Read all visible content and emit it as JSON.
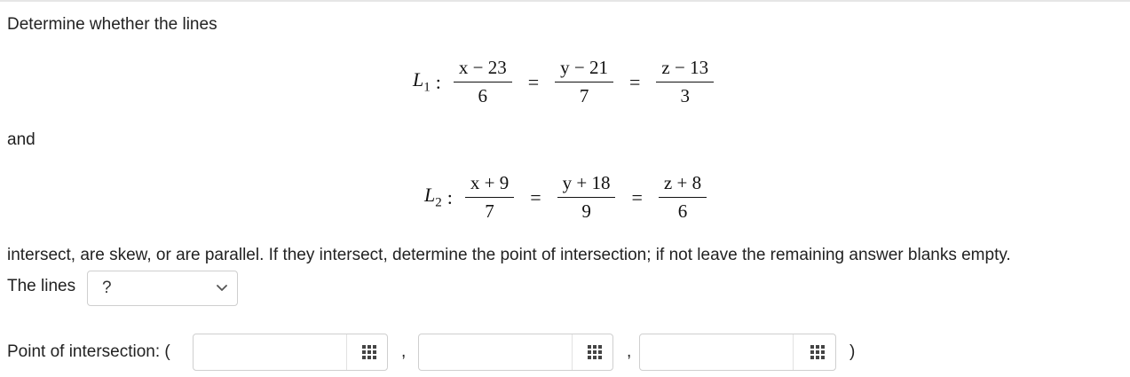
{
  "question": {
    "intro": "Determine whether the lines",
    "and": "and",
    "body": "intersect, are skew, or are parallel. If they intersect, determine the point of intersection; if not leave the remaining answer blanks empty.",
    "lines_label": "The lines",
    "point_label": "Point of intersection: (",
    "close_paren": ")",
    "separator": ","
  },
  "line1": {
    "name": "L",
    "sub": "1",
    "colon": ":",
    "x_num": "x − 23",
    "x_den": "6",
    "y_num": "y − 21",
    "y_den": "7",
    "z_num": "z − 13",
    "z_den": "3",
    "eq": "="
  },
  "line2": {
    "name": "L",
    "sub": "2",
    "colon": ":",
    "x_num": "x + 9",
    "x_den": "7",
    "y_num": "y + 18",
    "y_den": "9",
    "z_num": "z + 8",
    "z_den": "6",
    "eq": "="
  },
  "dropdown": {
    "selected": "?",
    "icon": "chevron-down-icon"
  },
  "inputs": [
    {
      "value": "",
      "icon": "grid-icon"
    },
    {
      "value": "",
      "icon": "grid-icon"
    },
    {
      "value": "",
      "icon": "grid-icon"
    }
  ]
}
